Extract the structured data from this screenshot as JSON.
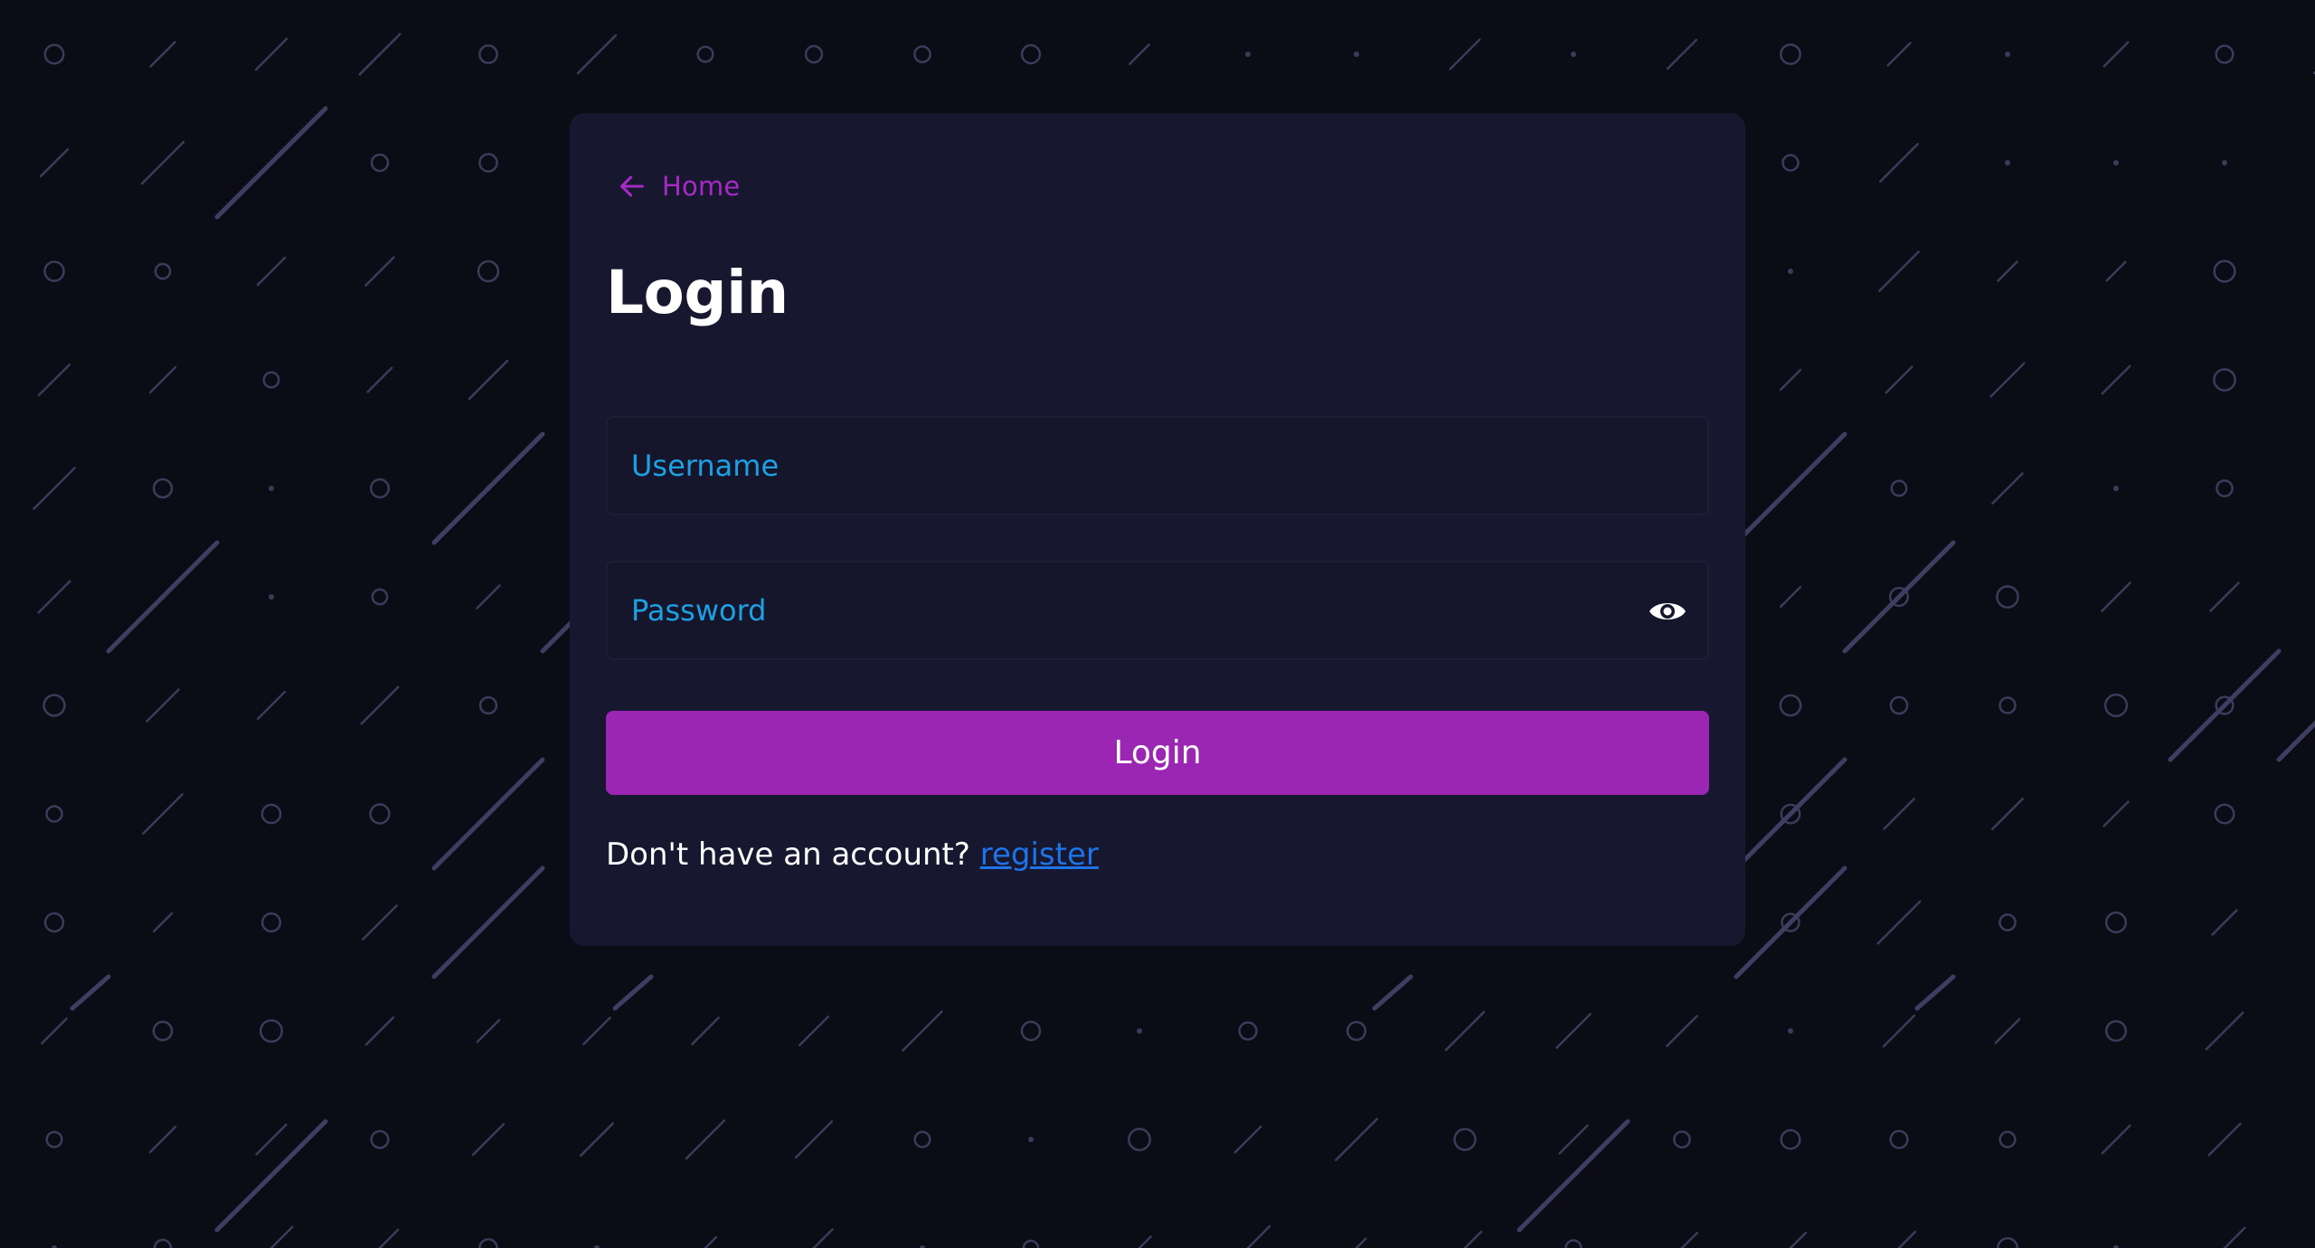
{
  "background": {
    "pattern": "diagonal-lines-and-circles",
    "color": "#0c0c16",
    "pattern_color": "#3b3b5a"
  },
  "nav": {
    "back_label": "Home",
    "back_icon": "arrow-left-icon"
  },
  "form": {
    "title": "Login",
    "username": {
      "placeholder": "Username",
      "value": ""
    },
    "password": {
      "placeholder": "Password",
      "value": "",
      "toggle_icon": "eye-icon"
    },
    "submit_label": "Login",
    "register_prompt": "Don't have an account?",
    "register_link": "register"
  },
  "colors": {
    "accent": "#9b26b4",
    "back_link": "#a62bc4",
    "placeholder": "#1ea1e3",
    "link": "#1e73e8",
    "card": "#171830"
  }
}
